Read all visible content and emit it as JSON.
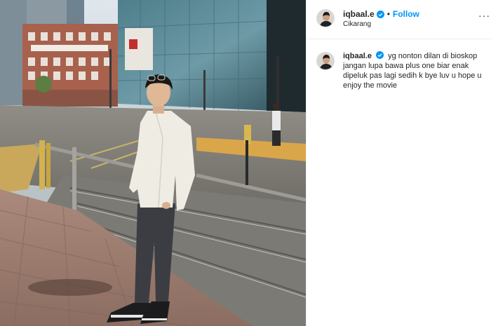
{
  "post": {
    "username": "iqbaal.e",
    "follow_label": "Follow",
    "separator": "•",
    "location": "Cikarang",
    "more_label": "···",
    "caption": {
      "username": "iqbaal.e",
      "text": "yg nonton dilan di bioskop jangan lupa bawa plus one biar enak dipeluk pas lagi sedih k bye luv u hope u enjoy the movie"
    }
  },
  "colors": {
    "accent": "#0095f6",
    "text": "#262626",
    "divider": "#efefef"
  },
  "icons": {
    "verified": "verified-badge-icon",
    "more": "more-options-icon"
  }
}
